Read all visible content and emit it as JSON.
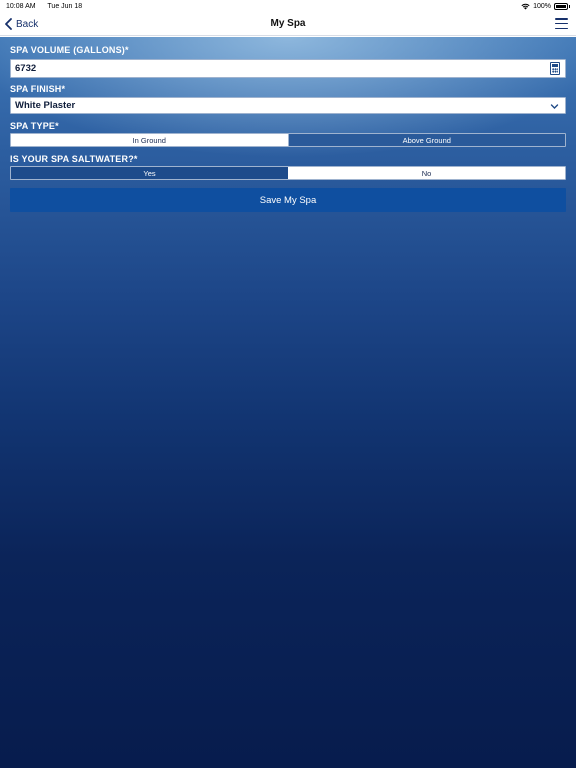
{
  "status_bar": {
    "time": "10:08 AM",
    "date": "Tue Jun 18",
    "battery": "100%"
  },
  "nav": {
    "back_label": "Back",
    "title": "My Spa",
    "menu_icon": "hamburger-menu-icon"
  },
  "form": {
    "volume": {
      "label": "SPA VOLUME (GALLONS)*",
      "value": "6732",
      "icon": "calculator-icon"
    },
    "finish": {
      "label": "SPA FINISH*",
      "value": "White Plaster",
      "icon": "chevron-down-icon"
    },
    "type": {
      "label": "SPA TYPE*",
      "options": [
        "In Ground",
        "Above Ground"
      ],
      "selected": "In Ground"
    },
    "saltwater": {
      "label": "IS YOUR SPA SALTWATER?*",
      "options": [
        "Yes",
        "No"
      ],
      "selected": "Yes"
    },
    "save_label": "Save My Spa"
  },
  "colors": {
    "accent": "#16306b",
    "save_button": "#0f4fa0",
    "background_top": "#3f77b6",
    "background_bottom": "#071c4d"
  }
}
